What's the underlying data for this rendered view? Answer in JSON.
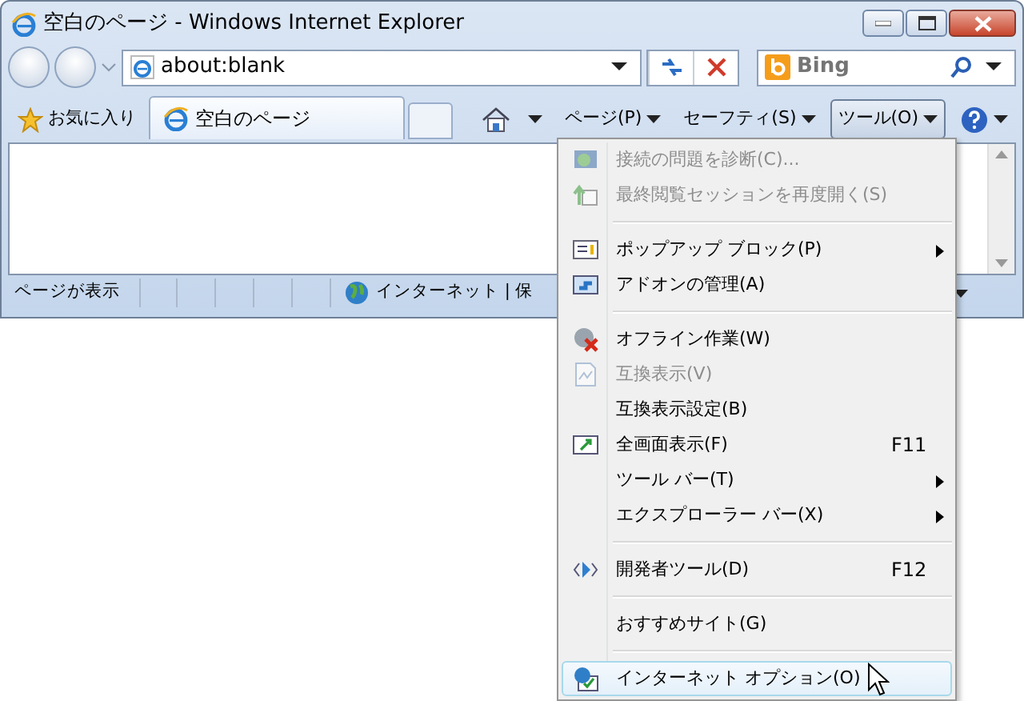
{
  "window": {
    "title": "空白のページ - Windows Internet Explorer"
  },
  "address_bar": {
    "value": "about:blank"
  },
  "search": {
    "placeholder": "Bing"
  },
  "favorites_button": {
    "label": "お気に入り"
  },
  "tabs": [
    {
      "label": "空白のページ",
      "selected": true
    }
  ],
  "command_bar": [
    {
      "label": "ページ(P)",
      "pressed": false
    },
    {
      "label": "セーフティ(S)",
      "pressed": false
    },
    {
      "label": "ツール(O)",
      "pressed": true
    }
  ],
  "status_bar": {
    "text": "ページが表示",
    "zone": "インターネット | 保"
  },
  "menu": {
    "items": [
      {
        "kind": "item",
        "label": "接続の問題を診断(C)...",
        "disabled": true,
        "submenu": false,
        "selected": false
      },
      {
        "kind": "item",
        "label": "最終閲覧セッションを再度開く(S)",
        "disabled": true,
        "submenu": false,
        "selected": false
      },
      {
        "kind": "separator"
      },
      {
        "kind": "item",
        "label": "ポップアップ ブロック(P)",
        "disabled": false,
        "submenu": true,
        "selected": false
      },
      {
        "kind": "item",
        "label": "アドオンの管理(A)",
        "disabled": false,
        "submenu": false,
        "selected": false
      },
      {
        "kind": "separator"
      },
      {
        "kind": "item",
        "label": "オフライン作業(W)",
        "disabled": false,
        "submenu": false,
        "selected": false
      },
      {
        "kind": "item",
        "label": "互換表示(V)",
        "disabled": true,
        "submenu": false,
        "selected": false
      },
      {
        "kind": "item",
        "label": "互換表示設定(B)",
        "disabled": false,
        "submenu": false,
        "selected": false
      },
      {
        "kind": "item",
        "label": "全画面表示(F)",
        "shortcut": "F11",
        "disabled": false,
        "submenu": false,
        "selected": false
      },
      {
        "kind": "item",
        "label": "ツール バー(T)",
        "disabled": false,
        "submenu": true,
        "selected": false
      },
      {
        "kind": "item",
        "label": "エクスプローラー バー(X)",
        "disabled": false,
        "submenu": true,
        "selected": false
      },
      {
        "kind": "separator"
      },
      {
        "kind": "item",
        "label": "開発者ツール(D)",
        "shortcut": "F12",
        "disabled": false,
        "submenu": false,
        "selected": false
      },
      {
        "kind": "separator"
      },
      {
        "kind": "item",
        "label": "おすすめサイト(G)",
        "disabled": false,
        "submenu": false,
        "selected": false
      },
      {
        "kind": "separator"
      },
      {
        "kind": "item",
        "label": "インターネット オプション(O)",
        "disabled": false,
        "submenu": false,
        "selected": true
      }
    ]
  }
}
